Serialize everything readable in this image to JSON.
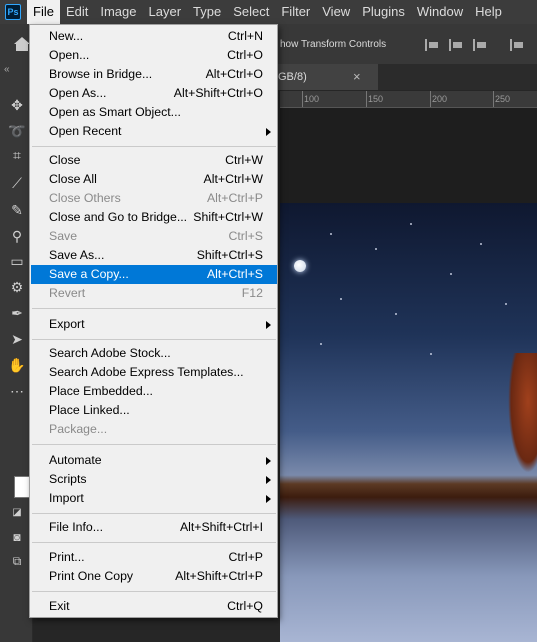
{
  "app": {
    "logo_text": "Ps"
  },
  "menubar": [
    "File",
    "Edit",
    "Image",
    "Layer",
    "Type",
    "Select",
    "Filter",
    "View",
    "Plugins",
    "Window",
    "Help"
  ],
  "options_bar": {
    "show_transform_controls": "how Transform Controls"
  },
  "document_tab": {
    "label": "GB/8)",
    "close_icon": "close-icon"
  },
  "ruler": {
    "ticks": [
      "100",
      "150",
      "200",
      "250"
    ]
  },
  "file_menu": [
    {
      "label": "New...",
      "shortcut": "Ctrl+N",
      "enabled": true
    },
    {
      "label": "Open...",
      "shortcut": "Ctrl+O",
      "enabled": true
    },
    {
      "label": "Browse in Bridge...",
      "shortcut": "Alt+Ctrl+O",
      "enabled": true
    },
    {
      "label": "Open As...",
      "shortcut": "Alt+Shift+Ctrl+O",
      "enabled": true
    },
    {
      "label": "Open as Smart Object...",
      "shortcut": "",
      "enabled": true
    },
    {
      "label": "Open Recent",
      "shortcut": "",
      "enabled": true,
      "submenu": true
    },
    {
      "separator": true
    },
    {
      "label": "Close",
      "shortcut": "Ctrl+W",
      "enabled": true
    },
    {
      "label": "Close All",
      "shortcut": "Alt+Ctrl+W",
      "enabled": true
    },
    {
      "label": "Close Others",
      "shortcut": "Alt+Ctrl+P",
      "enabled": false
    },
    {
      "label": "Close and Go to Bridge...",
      "shortcut": "Shift+Ctrl+W",
      "enabled": true
    },
    {
      "label": "Save",
      "shortcut": "Ctrl+S",
      "enabled": false
    },
    {
      "label": "Save As...",
      "shortcut": "Shift+Ctrl+S",
      "enabled": true
    },
    {
      "label": "Save a Copy...",
      "shortcut": "Alt+Ctrl+S",
      "enabled": true,
      "highlighted": true
    },
    {
      "label": "Revert",
      "shortcut": "F12",
      "enabled": false
    },
    {
      "separator": true
    },
    {
      "label": "Export",
      "shortcut": "",
      "enabled": true,
      "submenu": true
    },
    {
      "separator": true
    },
    {
      "label": "Search Adobe Stock...",
      "shortcut": "",
      "enabled": true
    },
    {
      "label": "Search Adobe Express Templates...",
      "shortcut": "",
      "enabled": true
    },
    {
      "label": "Place Embedded...",
      "shortcut": "",
      "enabled": true
    },
    {
      "label": "Place Linked...",
      "shortcut": "",
      "enabled": true
    },
    {
      "label": "Package...",
      "shortcut": "",
      "enabled": false
    },
    {
      "separator": true
    },
    {
      "label": "Automate",
      "shortcut": "",
      "enabled": true,
      "submenu": true
    },
    {
      "label": "Scripts",
      "shortcut": "",
      "enabled": true,
      "submenu": true
    },
    {
      "label": "Import",
      "shortcut": "",
      "enabled": true,
      "submenu": true
    },
    {
      "separator": true
    },
    {
      "label": "File Info...",
      "shortcut": "Alt+Shift+Ctrl+I",
      "enabled": true
    },
    {
      "separator": true
    },
    {
      "label": "Print...",
      "shortcut": "Ctrl+P",
      "enabled": true
    },
    {
      "label": "Print One Copy",
      "shortcut": "Alt+Shift+Ctrl+P",
      "enabled": true
    },
    {
      "separator": true
    },
    {
      "label": "Exit",
      "shortcut": "Ctrl+Q",
      "enabled": true
    }
  ],
  "toolbar": [
    "move-icon",
    "lasso-icon",
    "crop-icon",
    "eyedropper-icon",
    "brush-icon",
    "stamp-icon",
    "gradient-icon",
    "dodge-icon",
    "pen-icon",
    "select-arrow-icon",
    "hand-icon",
    "more-icon"
  ]
}
